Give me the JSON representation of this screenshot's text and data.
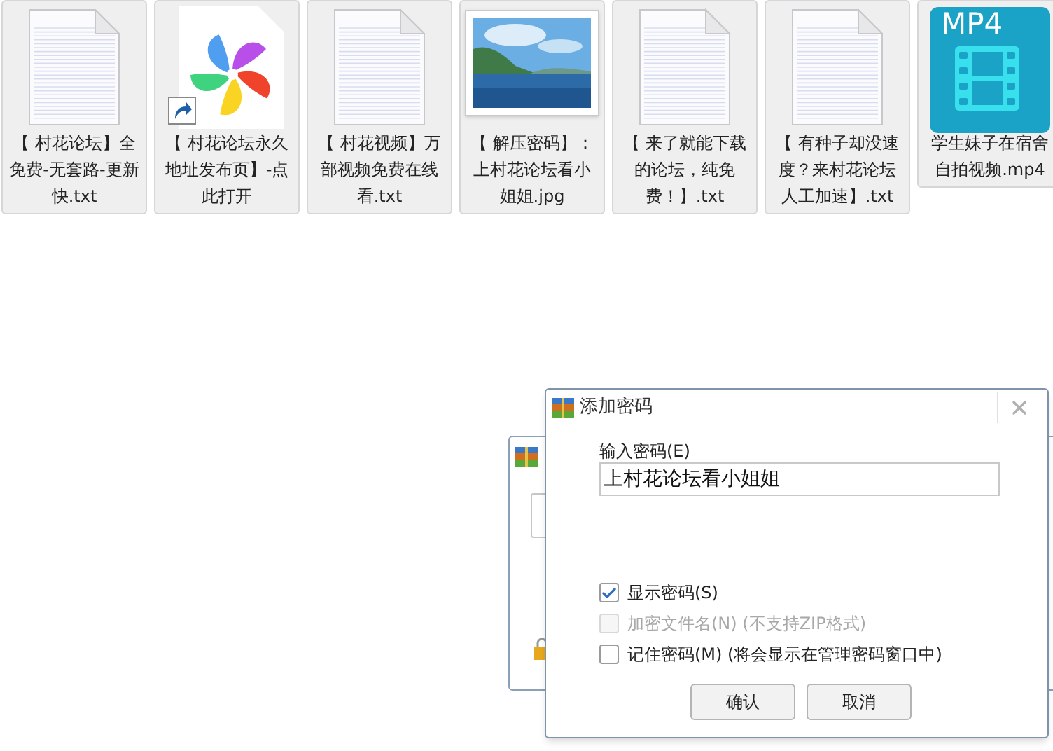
{
  "files": [
    {
      "kind": "text",
      "name": "【 村花论坛】全免费-无套路-更新快.txt"
    },
    {
      "kind": "shortcut",
      "name": "【 村花论坛永久地址发布页】-点此打开"
    },
    {
      "kind": "text",
      "name": "【 村花视频】万部视频免费在线看.txt"
    },
    {
      "name": "【 解压密码】：上村花论坛看小姐姐.jpg"
    },
    {
      "kind": "text",
      "name": "【 来了就能下载的论坛，纯免费！】.txt"
    },
    {
      "kind": "text",
      "name": "【 有种子却没速度？来村花论坛人工加速】.txt"
    },
    {
      "kind": "video",
      "badge": "MP4",
      "name": "学生妹子在宿舍自拍视频.mp4"
    }
  ],
  "dialog": {
    "title": "添加密码",
    "field_label": "输入密码(E)",
    "password": "上村花论坛看小姐姐",
    "options": [
      {
        "label": "显示密码(S)",
        "checked": true,
        "disabled": false
      },
      {
        "label": "加密文件名(N) (不支持ZIP格式)",
        "checked": false,
        "disabled": true
      },
      {
        "label": "记住密码(M) (将会显示在管理密码窗口中)",
        "checked": false,
        "disabled": false
      }
    ],
    "buttons": [
      "确认",
      "取消"
    ]
  }
}
